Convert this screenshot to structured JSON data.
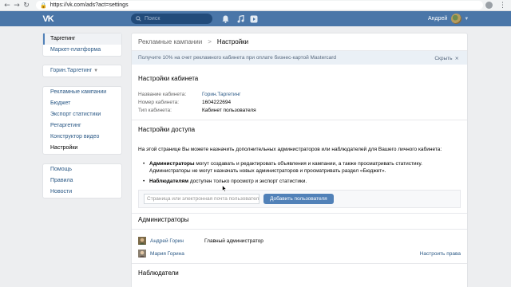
{
  "browser": {
    "url": "https://vk.com/ads?act=settings"
  },
  "header": {
    "logo": "VK",
    "search_placeholder": "Поиск",
    "user_name": "Андрей"
  },
  "left_nav": {
    "group1": [
      {
        "label": "Таргетинг",
        "active": true
      },
      {
        "label": "Маркет-платформа"
      }
    ],
    "account_selector": "Горин.Таргетинг",
    "group2": [
      {
        "label": "Рекламные кампании"
      },
      {
        "label": "Бюджет"
      },
      {
        "label": "Экспорт статистики"
      },
      {
        "label": "Ретаргетинг"
      },
      {
        "label": "Конструктор видео"
      },
      {
        "label": "Настройки",
        "bold": true
      }
    ],
    "group3": [
      {
        "label": "Помощь"
      },
      {
        "label": "Правила"
      },
      {
        "label": "Новости"
      }
    ]
  },
  "main": {
    "breadcrumb": {
      "parent": "Рекламные кампании",
      "separator": ">",
      "current": "Настройки"
    },
    "promo": {
      "text": "Получите 10% на счет рекламного кабинета при оплате бизнес-картой Mastercard",
      "hide_label": "Скрыть",
      "hide_icon": "close-icon"
    },
    "cabinet": {
      "title": "Настройки кабинета",
      "rows": [
        {
          "key": "Название кабинета:",
          "value": "Горин.Таргетинг"
        },
        {
          "key": "Номер кабинета:",
          "value": "1604222694"
        },
        {
          "key": "Тип кабинета:",
          "value": "Кабинет пользователя"
        }
      ]
    },
    "access": {
      "title": "Настройки доступа",
      "intro": "На этой странице Вы можете назначить дополнительных администраторов или наблюдателей для Вашего личного кабинета:",
      "bullet1_bold": "Администраторы",
      "bullet1_text": " могут создавать и редактировать объявления и кампании, а также просматривать статистику. Администраторы не могут назначать новых администраторов и просматривать раздел «Бюджет».",
      "bullet2_bold": "Наблюдателям",
      "bullet2_text": " доступен только просмотр и экспорт статистики.",
      "input_placeholder": "Страница или электронная почта пользователя",
      "add_button": "Добавить пользователя"
    },
    "admins": {
      "title": "Администраторы",
      "list": [
        {
          "name": "Андрей Горин",
          "role": "Главный администратор",
          "action": ""
        },
        {
          "name": "Мария Горина",
          "role": "",
          "action": "Настроить права"
        }
      ]
    },
    "observers": {
      "title": "Наблюдатели"
    }
  },
  "colors": {
    "vk_blue": "#4a76a8",
    "link": "#2a5885",
    "button": "#5181b8",
    "background": "#edeef0"
  }
}
